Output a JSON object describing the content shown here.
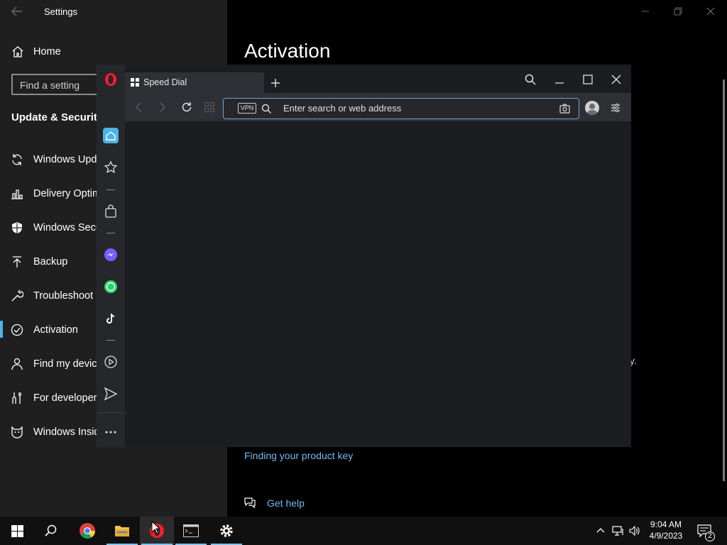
{
  "settings": {
    "title": "Settings",
    "home_label": "Home",
    "search_placeholder": "Find a setting",
    "section_title": "Update & Security",
    "nav_items": [
      {
        "label": "Windows Update",
        "icon": "sync-icon"
      },
      {
        "label": "Delivery Optimization",
        "icon": "delivery-optimization-icon"
      },
      {
        "label": "Windows Security",
        "icon": "shield-icon"
      },
      {
        "label": "Backup",
        "icon": "backup-arrow-icon"
      },
      {
        "label": "Troubleshoot",
        "icon": "wrench-icon"
      },
      {
        "label": "Activation",
        "icon": "check-circle-icon"
      },
      {
        "label": "Find my device",
        "icon": "person-location-icon"
      },
      {
        "label": "For developers",
        "icon": "developer-tools-icon"
      },
      {
        "label": "Windows Insider Program",
        "icon": "insider-cat-icon"
      }
    ],
    "selected_item": "Activation",
    "page_title": "Activation",
    "partial_text": "y.",
    "product_key_link": "Finding your product key",
    "get_help_label": "Get help",
    "accent_color": "#4fb3e6",
    "link_color": "#76b9ed"
  },
  "opera": {
    "tab_title": "Speed Dial",
    "address_placeholder": "Enter search or web address",
    "vpn_label": "VPN",
    "sidebar_icons": [
      "opera-logo-icon",
      "home-icon",
      "bookmark-star-icon",
      "shopping-bag-icon",
      "messenger-icon",
      "whatsapp-icon",
      "tiktok-icon",
      "player-icon",
      "send-icon",
      "more-icon"
    ],
    "brand_color": "#ff1b2d"
  },
  "taskbar": {
    "time": "9:04 AM",
    "date": "4/9/2023",
    "notification_count": "2",
    "apps": [
      "start-windows-icon",
      "search-icon",
      "chrome-icon",
      "file-explorer-icon",
      "opera-icon",
      "terminal-icon",
      "settings-gear-icon"
    ]
  }
}
